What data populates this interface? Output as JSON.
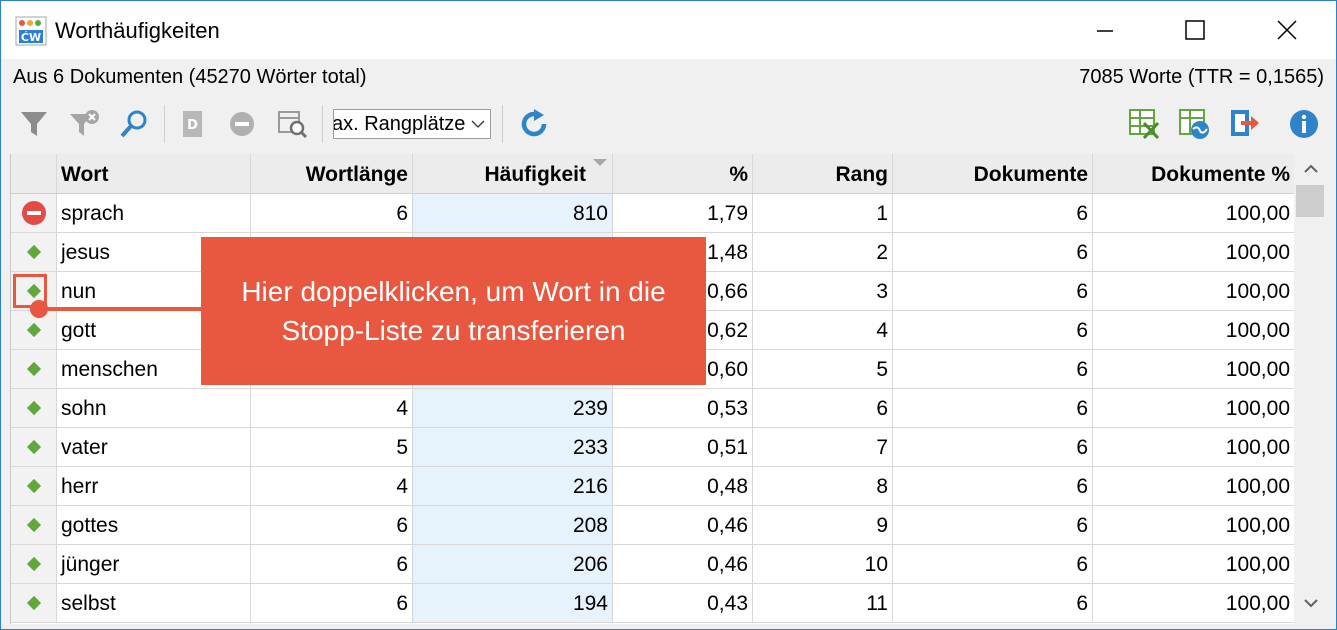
{
  "window": {
    "title": "Worthäufigkeiten"
  },
  "info": {
    "left": "Aus 6 Dokumenten (45270 Wörter total)",
    "right": "7085 Worte (TTR = 0,1565)"
  },
  "toolbar": {
    "icons": [
      "filter-icon",
      "clear-filter-icon",
      "search-icon",
      "document-icon",
      "stop-icon",
      "table-search-icon",
      "refresh-icon",
      "excel-export-icon",
      "web-export-icon",
      "export-icon",
      "info-icon"
    ],
    "dropdown_value": "ax. Rangplätze"
  },
  "table": {
    "columns": [
      "Wort",
      "Wortlänge",
      "Häufigkeit",
      "%",
      "Rang",
      "Dokumente",
      "Dokumente %"
    ],
    "sort_column": "Häufigkeit",
    "rows": [
      {
        "marker": "stop",
        "word": "sprach",
        "len": "6",
        "freq": "810",
        "pct": "1,79",
        "rank": "1",
        "docs": "6",
        "docspct": "100,00"
      },
      {
        "marker": "diamond",
        "word": "jesus",
        "len": "",
        "freq": "",
        "pct": "1,48",
        "rank": "2",
        "docs": "6",
        "docspct": "100,00"
      },
      {
        "marker": "diamond",
        "word": "nun",
        "len": "",
        "freq": "",
        "pct": "0,66",
        "rank": "3",
        "docs": "6",
        "docspct": "100,00"
      },
      {
        "marker": "diamond",
        "word": "gott",
        "len": "",
        "freq": "",
        "pct": "0,62",
        "rank": "4",
        "docs": "6",
        "docspct": "100,00"
      },
      {
        "marker": "diamond",
        "word": "menschen",
        "len": "",
        "freq": "",
        "pct": "0,60",
        "rank": "5",
        "docs": "6",
        "docspct": "100,00"
      },
      {
        "marker": "diamond",
        "word": "sohn",
        "len": "4",
        "freq": "239",
        "pct": "0,53",
        "rank": "6",
        "docs": "6",
        "docspct": "100,00"
      },
      {
        "marker": "diamond",
        "word": "vater",
        "len": "5",
        "freq": "233",
        "pct": "0,51",
        "rank": "7",
        "docs": "6",
        "docspct": "100,00"
      },
      {
        "marker": "diamond",
        "word": "herr",
        "len": "4",
        "freq": "216",
        "pct": "0,48",
        "rank": "8",
        "docs": "6",
        "docspct": "100,00"
      },
      {
        "marker": "diamond",
        "word": "gottes",
        "len": "6",
        "freq": "208",
        "pct": "0,46",
        "rank": "9",
        "docs": "6",
        "docspct": "100,00"
      },
      {
        "marker": "diamond",
        "word": "jünger",
        "len": "6",
        "freq": "206",
        "pct": "0,46",
        "rank": "10",
        "docs": "6",
        "docspct": "100,00"
      },
      {
        "marker": "diamond",
        "word": "selbst",
        "len": "6",
        "freq": "194",
        "pct": "0,43",
        "rank": "11",
        "docs": "6",
        "docspct": "100,00"
      }
    ]
  },
  "callout": {
    "line1": "Hier doppelklicken, um Wort in die",
    "line2": "Stopp-Liste zu transferieren"
  },
  "colors": {
    "accent": "#e8573f",
    "diamond": "#62a73b",
    "stop": "#e34b47",
    "freq_bg": "#e6f3fd",
    "window_border": "#2b7fd4"
  }
}
